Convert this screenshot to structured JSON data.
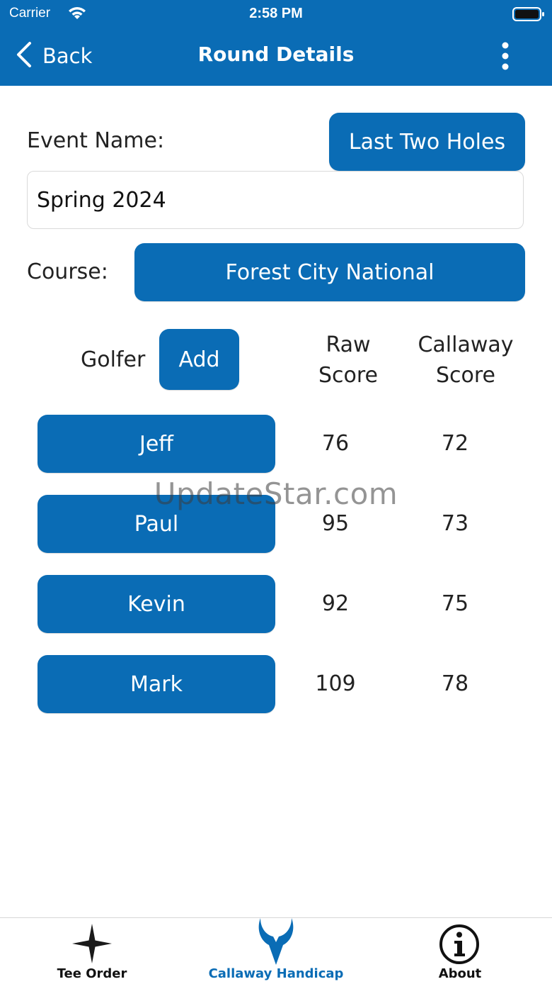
{
  "status_bar": {
    "carrier": "Carrier",
    "time": "2:58 PM"
  },
  "nav": {
    "back_label": "Back",
    "title": "Round Details"
  },
  "form": {
    "event_label": "Event Name:",
    "last_two_label": "Last Two Holes",
    "event_value": "Spring 2024",
    "course_label": "Course:",
    "course_value": "Forest City National"
  },
  "table": {
    "golfer_header": "Golfer",
    "add_label": "Add",
    "raw_header_1": "Raw",
    "raw_header_2": "Score",
    "callaway_header_1": "Callaway",
    "callaway_header_2": "Score",
    "rows": [
      {
        "name": "Jeff",
        "raw": "76",
        "callaway": "72"
      },
      {
        "name": "Paul",
        "raw": "95",
        "callaway": "73"
      },
      {
        "name": "Kevin",
        "raw": "92",
        "callaway": "75"
      },
      {
        "name": "Mark",
        "raw": "109",
        "callaway": "78"
      }
    ]
  },
  "watermark": "UpdateStar.com",
  "tabbar": {
    "items": [
      {
        "label": "Tee Order",
        "icon": "star-icon"
      },
      {
        "label": "Callaway Handicap",
        "icon": "callaway-icon"
      },
      {
        "label": "About",
        "icon": "info-icon"
      }
    ]
  },
  "colors": {
    "accent": "#0a6cb5",
    "text": "#222222",
    "tab_inactive": "#111111"
  }
}
